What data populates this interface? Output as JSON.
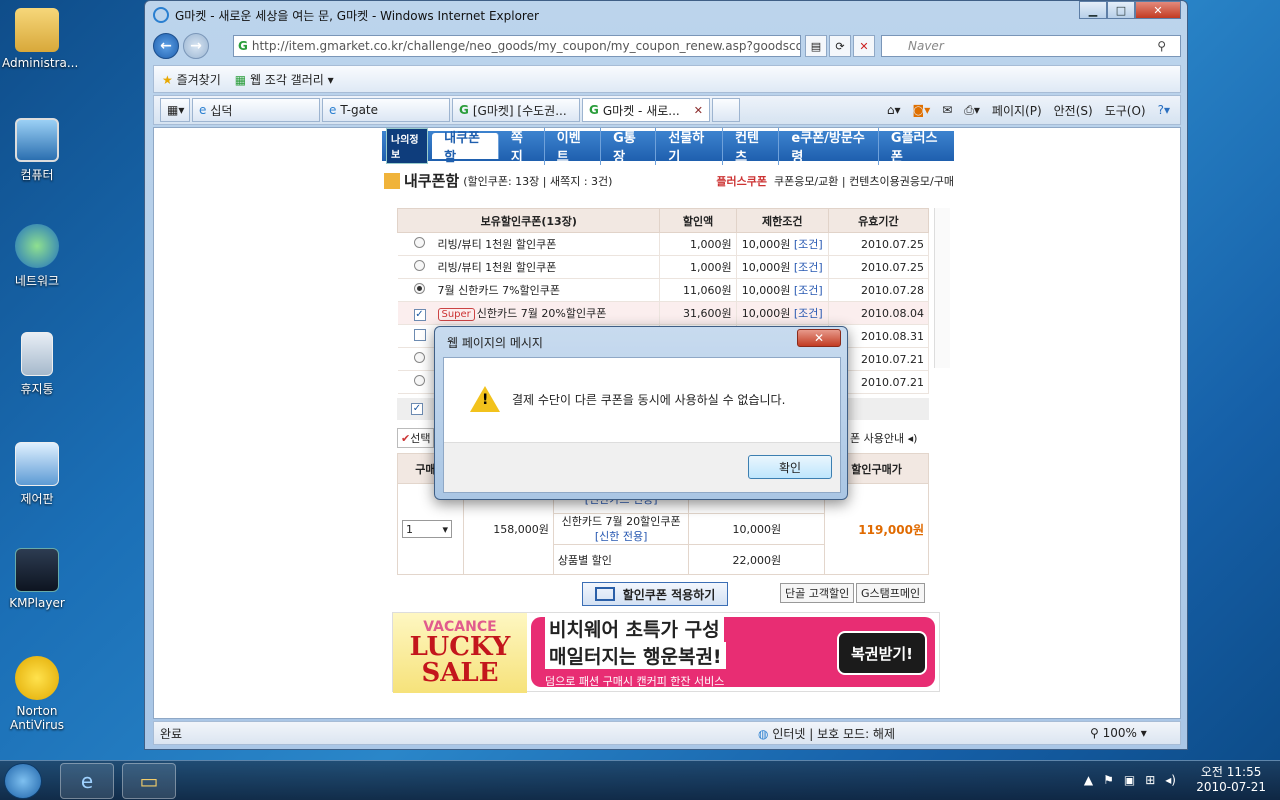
{
  "desktop": {
    "icons": [
      {
        "label": "Administra..."
      },
      {
        "label": "컴퓨터"
      },
      {
        "label": "네트워크"
      },
      {
        "label": "휴지통"
      },
      {
        "label": "제어판"
      },
      {
        "label": "KMPlayer"
      },
      {
        "label": "Norton AntiVirus"
      }
    ]
  },
  "browser": {
    "title": "G마켓 - 새로운 세상을 여는 문, G마켓 - Windows Internet Explorer",
    "url": "http://item.gmarket.co.kr/challenge/neo_goods/my_coupon/my_coupon_renew.asp?goodscode=",
    "search_placeholder": "Naver",
    "favorites_label": "즐겨찾기",
    "web_slice_label": "웹 조각 갤러리",
    "tabs": [
      {
        "label": "십덕"
      },
      {
        "label": "T-gate"
      },
      {
        "label": "[G마켓] [수도권..."
      },
      {
        "label": "G마켓 - 새로..."
      }
    ],
    "commands": {
      "page": "페이지(P)",
      "safety": "안전(S)",
      "tools": "도구(O)"
    },
    "status": {
      "text": "완료",
      "zone": "인터넷 | 보호 모드: 해제",
      "zoom": "100%"
    }
  },
  "page": {
    "nav": {
      "my_info": "나의정보",
      "items": [
        "내쿠폰함",
        "쪽지",
        "이벤트",
        "G통장",
        "선물하기",
        "컨텐츠",
        "e쿠폰/방문수령",
        "G플러스폰"
      ]
    },
    "header": {
      "title": "내쿠폰함",
      "summary": "(할인쿠폰: 13장 | 새쪽지 : 3건)",
      "link1": "플러스쿠폰",
      "link2": "쿠폰응모/교환",
      "link3": "컨텐츠이용권응모/구매"
    },
    "coupon_table": {
      "headers": [
        "보유할인쿠폰(13장)",
        "할인액",
        "제한조건",
        "유효기간"
      ],
      "condition_link": "[조건]",
      "rows": [
        {
          "name": "리빙/뷰티 1천원 할인쿠폰",
          "amount": "1,000원",
          "limit": "10,000원",
          "expiry": "2010.07.25",
          "select": "radio",
          "checked": false,
          "super": ""
        },
        {
          "name": "리빙/뷰티 1천원 할인쿠폰",
          "amount": "1,000원",
          "limit": "10,000원",
          "expiry": "2010.07.25",
          "select": "radio",
          "checked": false,
          "super": ""
        },
        {
          "name": "7월 신한카드 7%할인쿠폰",
          "amount": "11,060원",
          "limit": "10,000원",
          "expiry": "2010.07.28",
          "select": "radio",
          "checked": true,
          "super": ""
        },
        {
          "name": "신한카드 7월 20%할인쿠폰",
          "amount": "31,600원",
          "limit": "10,000원",
          "expiry": "2010.08.04",
          "select": "check",
          "checked": true,
          "super": "Super"
        },
        {
          "name": "",
          "amount": "",
          "limit": "",
          "expiry": "2010.08.31",
          "select": "check",
          "checked": false,
          "super": ""
        },
        {
          "name": "",
          "amount": "",
          "limit": "",
          "expiry": "2010.07.21",
          "select": "radio",
          "checked": false,
          "super": ""
        },
        {
          "name": "",
          "amount": "",
          "limit": "",
          "expiry": "2010.07.21",
          "select": "radio",
          "checked": false,
          "super": ""
        }
      ]
    },
    "partial_text": {
      "selected": "선택",
      "usage": "폰 사용안내"
    },
    "order": {
      "qty_header": "구매수",
      "final_header": "할인구매가",
      "qty": "1",
      "price": "158,000원",
      "shinhan_only_a": "[신한카드 전용]",
      "coupon_name": "신한카드 7월 20할인쿠폰",
      "shinhan_only": "[신한 전용]",
      "coupon_discount": "10,000원",
      "item_discount_label": "상품별 할인",
      "item_discount": "22,000원",
      "final_price": "119,000원"
    },
    "buttons": {
      "apply": "할인쿠폰 적용하기",
      "regular": "단골 고객할인",
      "stamp": "G스탬프메인"
    },
    "banner": {
      "vacance": "VACANCE",
      "lucky": "LUCKY",
      "sale": "SALE",
      "line1": "비치웨어 초특가 구성",
      "line2": "매일터지는 행운복권!",
      "line3": "덤으로 패션 구매시 캔커피 한잔 서비스",
      "cta": "복권받기!"
    }
  },
  "dialog": {
    "title": "웹 페이지의 메시지",
    "message": "결제 수단이 다른 쿠폰을 동시에 사용하실 수 없습니다.",
    "ok": "확인"
  },
  "taskbar": {
    "time": "오전 11:55",
    "date": "2010-07-21"
  }
}
